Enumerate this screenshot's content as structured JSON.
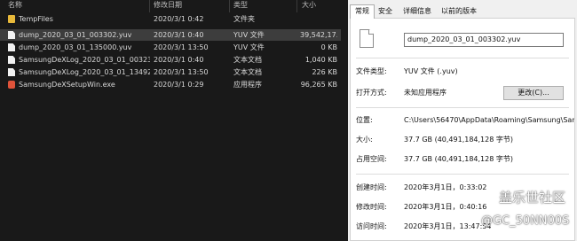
{
  "explorer": {
    "columns": {
      "name": "名称",
      "date": "修改日期",
      "type": "类型",
      "size": "大小"
    },
    "files": [
      {
        "name": "TempFiles",
        "date": "2020/3/1 0:42",
        "type": "文件夹",
        "size": "",
        "icon": "folder-icon",
        "selected": false
      },
      {
        "name": "dump_2020_03_01_003302.yuv",
        "date": "2020/3/1 0:40",
        "type": "YUV 文件",
        "size": "39,542,17...",
        "icon": "file-icon",
        "selected": true
      },
      {
        "name": "dump_2020_03_01_135000.yuv",
        "date": "2020/3/1 13:50",
        "type": "YUV 文件",
        "size": "0 KB",
        "icon": "file-icon",
        "selected": false
      },
      {
        "name": "SamsungDeXLog_2020_03_01_003237...",
        "date": "2020/3/1 0:40",
        "type": "文本文档",
        "size": "1,040 KB",
        "icon": "file-icon",
        "selected": false
      },
      {
        "name": "SamsungDeXLog_2020_03_01_134929...",
        "date": "2020/3/1 13:50",
        "type": "文本文档",
        "size": "226 KB",
        "icon": "file-icon",
        "selected": false
      },
      {
        "name": "SamsungDeXSetupWin.exe",
        "date": "2020/3/1 0:29",
        "type": "应用程序",
        "size": "96,265 KB",
        "icon": "exe-icon",
        "selected": false
      }
    ]
  },
  "dialog": {
    "tabs": [
      {
        "label": "常规",
        "active": true
      },
      {
        "label": "安全",
        "active": false
      },
      {
        "label": "详细信息",
        "active": false
      },
      {
        "label": "以前的版本",
        "active": false
      }
    ],
    "filename": "dump_2020_03_01_003302.yuv",
    "file_type_label": "文件类型:",
    "file_type_value": "YUV 文件 (.yuv)",
    "open_with_label": "打开方式:",
    "open_with_value": "未知应用程序",
    "change_button": "更改(C)...",
    "location_label": "位置:",
    "location_value": "C:\\Users\\56470\\AppData\\Roaming\\Samsung\\Sams",
    "size_label": "大小:",
    "size_value": "37.7 GB (40,491,184,128 字节)",
    "size_on_disk_label": "占用空间:",
    "size_on_disk_value": "37.7 GB (40,491,184,128 字节)",
    "created_label": "创建时间:",
    "created_value": "2020年3月1日，0:33:02",
    "modified_label": "修改时间:",
    "modified_value": "2020年3月1日，0:40:16",
    "accessed_label": "访问时间:",
    "accessed_value": "2020年3月1日，13:47:54"
  },
  "watermark": {
    "line1": "盖乐世社区",
    "line2": "@GC_50NN00S"
  }
}
